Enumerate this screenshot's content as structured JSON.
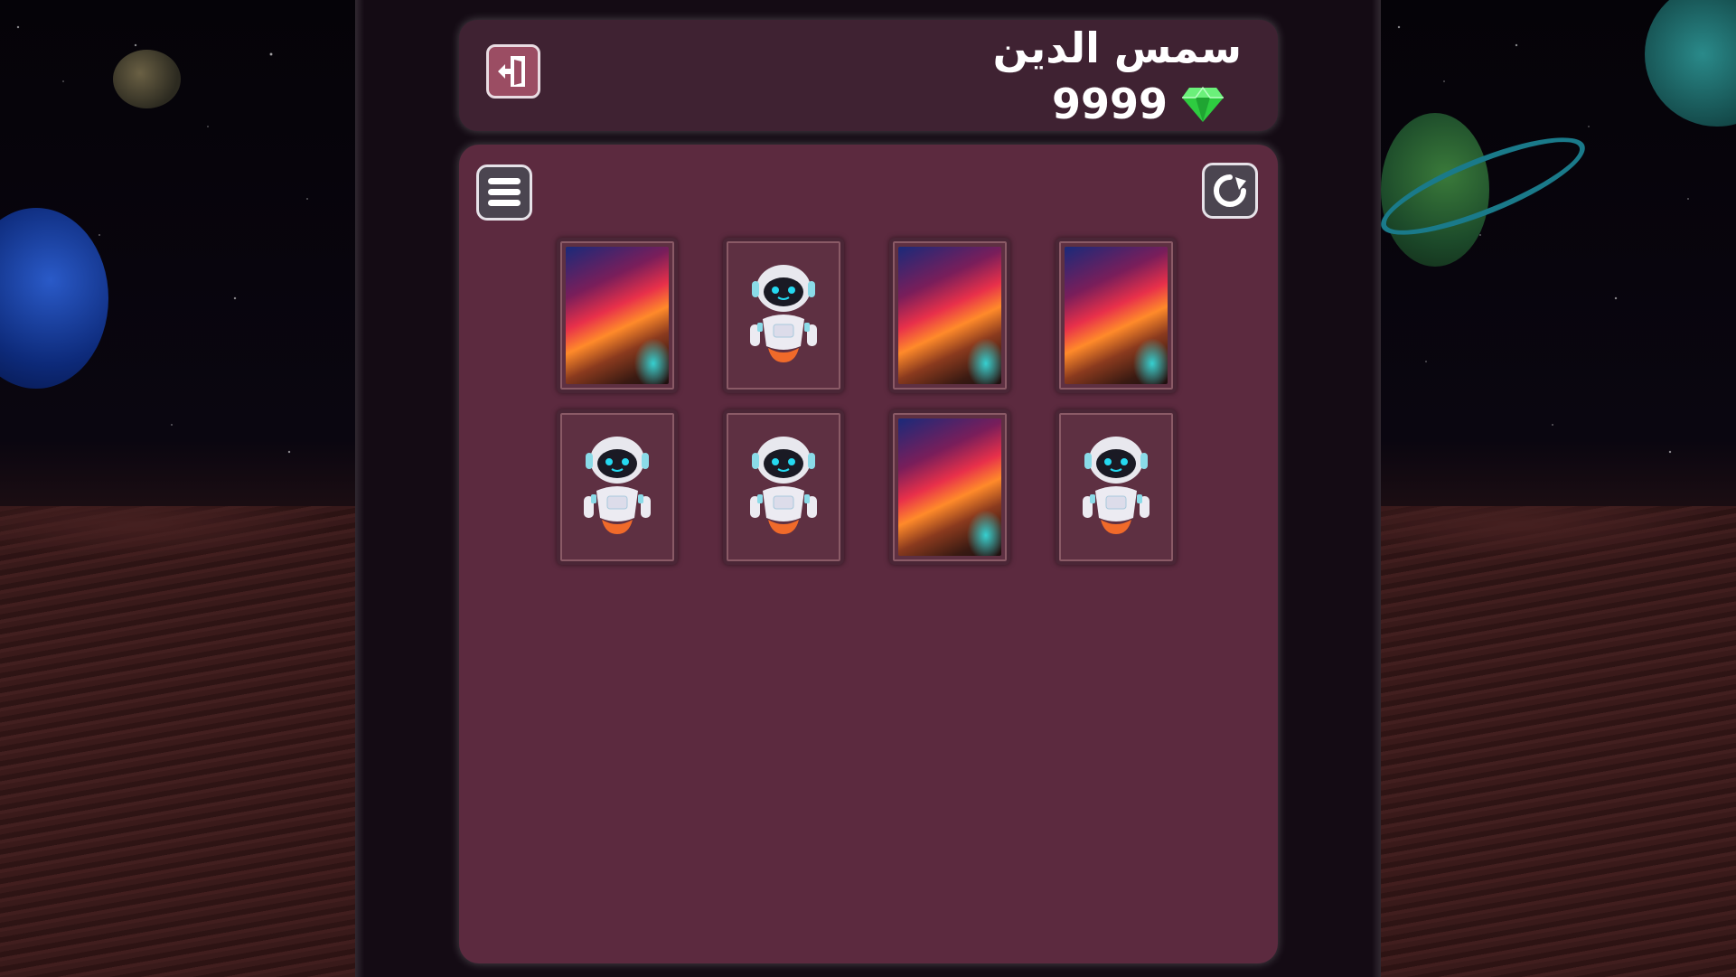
{
  "header": {
    "player_name": "سمس الدين",
    "gems": "9999",
    "gem_icon": "gem-icon",
    "exit_icon": "exit-door-icon"
  },
  "board": {
    "menu_icon": "menu-icon",
    "restart_icon": "restart-icon",
    "cards": [
      {
        "state": "back"
      },
      {
        "state": "robot"
      },
      {
        "state": "back"
      },
      {
        "state": "back"
      },
      {
        "state": "robot"
      },
      {
        "state": "robot"
      },
      {
        "state": "back"
      },
      {
        "state": "robot"
      }
    ]
  },
  "colors": {
    "panel": "#3f2232",
    "board": "#5c2a3f",
    "gem": "#2ecc40",
    "exit_button": "#9b4d63"
  }
}
